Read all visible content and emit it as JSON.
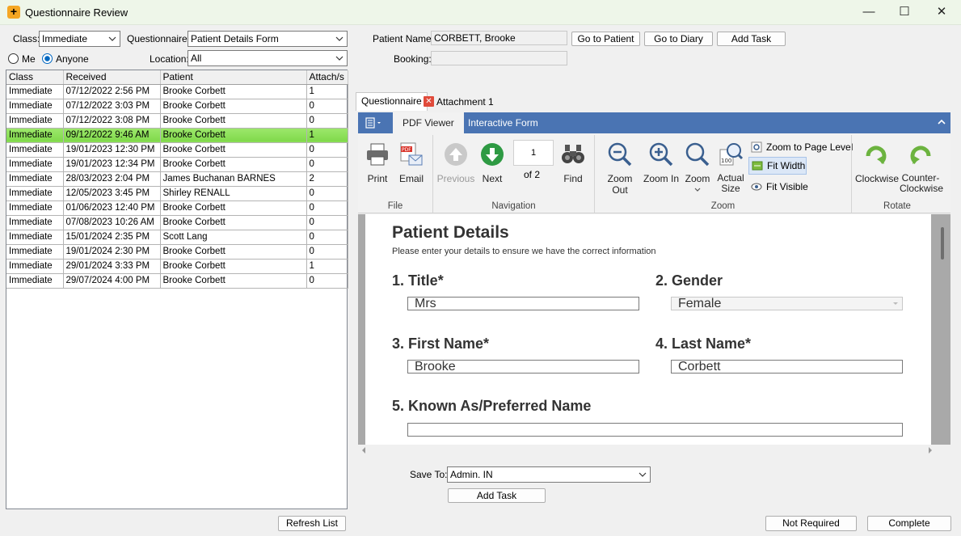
{
  "window": {
    "title": "Questionnaire Review",
    "minimize": "—",
    "maximize": "☐",
    "close": "✕"
  },
  "filters": {
    "class_label": "Class:",
    "class_value": "Immediate",
    "questionnaire_label": "Questionnaire:",
    "questionnaire_value": "Patient Details Form",
    "me_label": "Me",
    "anyone_label": "Anyone",
    "scope_selected": "Anyone",
    "location_label": "Location:",
    "location_value": "All"
  },
  "patient": {
    "name_label": "Patient Name:",
    "name_value": "CORBETT, Brooke",
    "booking_label": "Booking:",
    "booking_value": "",
    "go_to_patient": "Go to Patient",
    "go_to_diary": "Go to Diary",
    "add_task": "Add Task"
  },
  "grid": {
    "columns": [
      "Class",
      "Received",
      "Patient",
      "Attach/s"
    ],
    "selected_index": 3,
    "rows": [
      [
        "Immediate",
        "07/12/2022 2:56 PM",
        "Brooke Corbett",
        "1"
      ],
      [
        "Immediate",
        "07/12/2022 3:03 PM",
        "Brooke Corbett",
        "0"
      ],
      [
        "Immediate",
        "07/12/2022 3:08 PM",
        "Brooke Corbett",
        "0"
      ],
      [
        "Immediate",
        "09/12/2022 9:46 AM",
        "Brooke Corbett",
        "1"
      ],
      [
        "Immediate",
        "19/01/2023 12:30 PM",
        "Brooke Corbett",
        "0"
      ],
      [
        "Immediate",
        "19/01/2023 12:34 PM",
        "Brooke Corbett",
        "0"
      ],
      [
        "Immediate",
        "28/03/2023 2:04 PM",
        "James Buchanan BARNES",
        "2"
      ],
      [
        "Immediate",
        "12/05/2023 3:45 PM",
        "Shirley RENALL",
        "0"
      ],
      [
        "Immediate",
        "01/06/2023 12:40 PM",
        "Brooke Corbett",
        "0"
      ],
      [
        "Immediate",
        "07/08/2023 10:26 AM",
        "Brooke Corbett",
        "0"
      ],
      [
        "Immediate",
        "15/01/2024 2:35 PM",
        "Scott Lang",
        "0"
      ],
      [
        "Immediate",
        "19/01/2024 2:30 PM",
        "Brooke Corbett",
        "0"
      ],
      [
        "Immediate",
        "29/01/2024 3:33 PM",
        "Brooke Corbett",
        "1"
      ],
      [
        "Immediate",
        "29/07/2024 4:00 PM",
        "Brooke Corbett",
        "0"
      ]
    ]
  },
  "refresh_list": "Refresh List",
  "doc_tabs": {
    "questionnaire": "Questionnaire",
    "attachment": "Attachment 1"
  },
  "ribbon": {
    "tabs": {
      "pdf_viewer": "PDF Viewer",
      "interactive_form": "Interactive Form"
    },
    "file": {
      "group": "File",
      "print": "Print",
      "email": "Email"
    },
    "navigation": {
      "group": "Navigation",
      "previous": "Previous",
      "next": "Next",
      "page": "1",
      "of": "of 2",
      "find": "Find"
    },
    "zoom": {
      "group": "Zoom",
      "zoom_out": "Zoom Out",
      "zoom_in": "Zoom In",
      "zoom": "Zoom",
      "actual_size_1": "Actual",
      "actual_size_2": "Size",
      "page_level": "Zoom to Page Level",
      "fit_width": "Fit Width",
      "fit_visible": "Fit Visible"
    },
    "rotate": {
      "group": "Rotate",
      "clockwise": "Clockwise",
      "counter_1": "Counter-",
      "counter_2": "Clockwise"
    }
  },
  "form": {
    "title": "Patient Details",
    "subtitle": "Please enter your details to ensure we have the correct information",
    "q1": "1. Title*",
    "q1_value": "Mrs",
    "q2": "2. Gender",
    "q2_value": "Female",
    "q3": "3. First Name*",
    "q3_value": "Brooke",
    "q4": "4. Last Name*",
    "q4_value": "Corbett",
    "q5": "5. Known As/Preferred Name",
    "q5_value": ""
  },
  "save": {
    "label": "Save To:",
    "value": "Admin. IN",
    "add_task": "Add Task"
  },
  "footer": {
    "not_required": "Not Required",
    "complete": "Complete"
  },
  "colors": {
    "ribbon": "#4a74b3",
    "selected_row": "#8fe05a",
    "titlebar": "#eef6e9"
  }
}
